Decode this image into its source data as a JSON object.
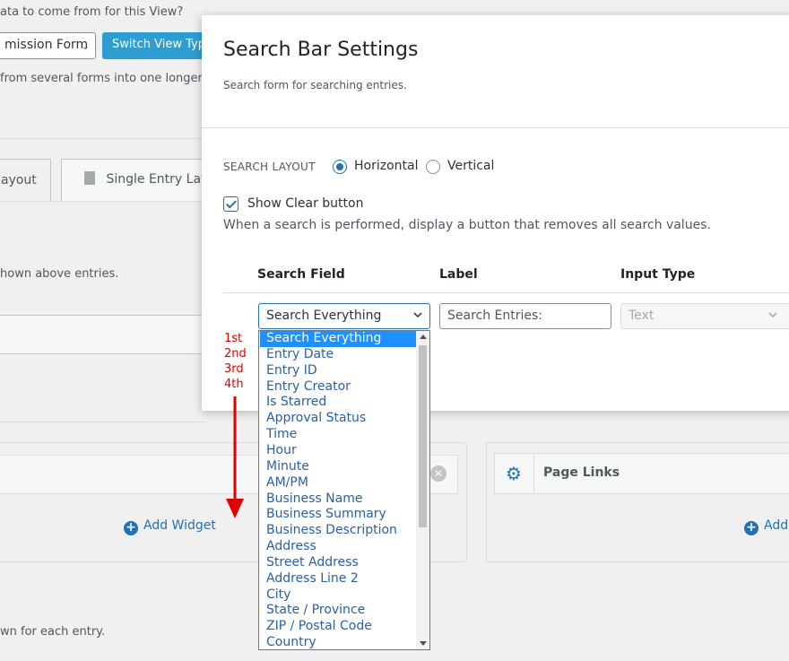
{
  "background": {
    "question": "ata to come from for this View?",
    "form_select": "mission Form",
    "switch_button": "Switch View Type",
    "note": "from several forms into one longer ent",
    "tabs": [
      {
        "label": "ayout"
      },
      {
        "label": "Single Entry Lay"
      }
    ],
    "shown_above": "hown above entries.",
    "widget_zone_right_title": "Page Links",
    "add_widget_left": "Add Widget",
    "add_widget_right": "Add",
    "shown_each": "wn for each entry."
  },
  "modal": {
    "title": "Search Bar Settings",
    "subtitle": "Search form for searching entries.",
    "layout_label": "SEARCH LAYOUT",
    "layout_options": [
      {
        "label": "Horizontal",
        "checked": true
      },
      {
        "label": "Vertical",
        "checked": false
      }
    ],
    "show_clear_label": "Show Clear button",
    "show_clear_help": "When a search is performed, display a button that removes all search values.",
    "columns": {
      "field": "Search Field",
      "label": "Label",
      "input_type": "Input Type"
    },
    "row": {
      "field_value": "Search Everything",
      "label_value": "Search Entries:",
      "input_type_value": "Text"
    }
  },
  "dropdown": {
    "options": [
      "Search Everything",
      "Entry Date",
      "Entry ID",
      "Entry Creator",
      "Is Starred",
      "Approval Status",
      "Time",
      "Hour",
      "Minute",
      "AM/PM",
      "Business Name",
      "Business Summary",
      "Business Description",
      "Address",
      "Street Address",
      "Address Line 2",
      "City",
      "State / Province",
      "ZIP / Postal Code",
      "Country"
    ],
    "selected_index": 0
  },
  "annotation": {
    "labels": [
      "1st",
      "2nd",
      "3rd",
      "4th"
    ],
    "color": "#e00000"
  },
  "colors": {
    "accent": "#2271b1",
    "button": "#2e9ed2",
    "selected_option": "#1e90ff"
  }
}
